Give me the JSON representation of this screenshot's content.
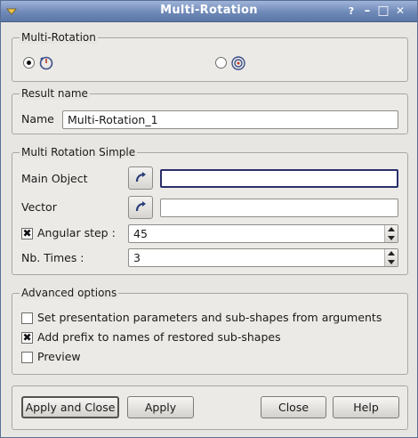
{
  "window": {
    "title": "Multi-Rotation",
    "controls": {
      "help": "?",
      "minimize": "–",
      "maximize": "□",
      "close": "✕"
    }
  },
  "constructor_group": {
    "legend": "Multi-Rotation",
    "options": [
      {
        "icon": "multi-rotation-simple-icon",
        "selected": true
      },
      {
        "icon": "multi-rotation-double-icon",
        "selected": false
      }
    ]
  },
  "result_group": {
    "legend": "Result name",
    "name_label": "Name",
    "name_value": "Multi-Rotation_1"
  },
  "simple_group": {
    "legend": "Multi Rotation Simple",
    "main_object_label": "Main Object",
    "main_object_value": "",
    "vector_label": "Vector",
    "vector_value": "",
    "angular_step_label": "Angular step :",
    "angular_step_checked": true,
    "angular_step_value": "45",
    "nb_times_label": "Nb. Times :",
    "nb_times_value": "3"
  },
  "advanced_group": {
    "legend": "Advanced options",
    "options": [
      {
        "label": "Set presentation parameters and sub-shapes from arguments",
        "checked": false
      },
      {
        "label": "Add prefix to names of restored sub-shapes",
        "checked": true
      },
      {
        "label": "Preview",
        "checked": false
      }
    ]
  },
  "buttons": {
    "apply_and_close": "Apply and Close",
    "apply": "Apply",
    "close": "Close",
    "help": "Help"
  },
  "colors": {
    "titlebar": "#6f89b8",
    "focus_border": "#2a2f6b",
    "dialog_bg": "#e8e6e2"
  }
}
